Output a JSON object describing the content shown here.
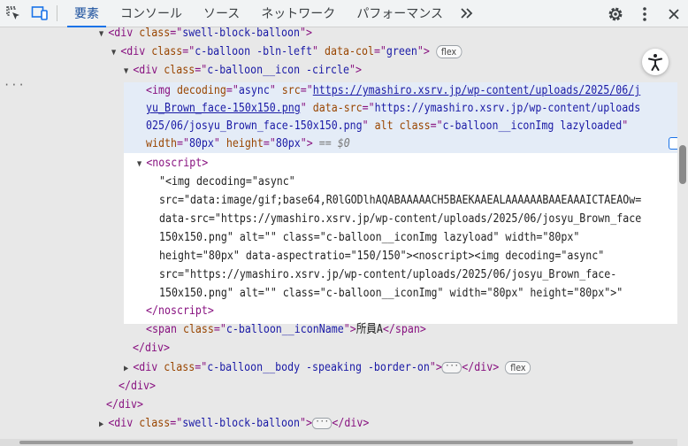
{
  "toolbar": {
    "tabs": [
      {
        "label": "要素",
        "active": true
      },
      {
        "label": "コンソール"
      },
      {
        "label": "ソース"
      },
      {
        "label": "ネットワーク"
      },
      {
        "label": "パフォーマンス"
      }
    ],
    "more_tabs_icon": "double-chevron-right-icon",
    "icons": [
      "inspect-element-icon",
      "device-toolbar-icon",
      "settings-icon",
      "more-vert-icon",
      "close-icon"
    ]
  },
  "tree": {
    "line1": {
      "open": "<div ",
      "attr": "class",
      "eq": "=\"",
      "val": "swell-block-balloon",
      "close": "\">"
    },
    "line2": {
      "open": "<div ",
      "attr": "class",
      "eq": "=\"",
      "val": "c-balloon -bln-left",
      "q": "\" ",
      "attr2": "data-col",
      "eq2": "=\"",
      "val2": "green",
      "close": "\">",
      "badge": "flex"
    },
    "line3": {
      "open": "<div ",
      "attr": "class",
      "eq": "=\"",
      "val": "c-balloon__icon -circle",
      "close": "\">"
    },
    "img": {
      "l1_a": "<img ",
      "l1_b": "decoding",
      "l1_c": "=\"",
      "l1_d": "async",
      "l1_e": "\" ",
      "l1_f": "src",
      "l1_g": "=\"",
      "l1_h": "https://ymashiro.xsrv.jp/wp-content/uploads/2025/06/j",
      "l2_a": "yu_Brown_face-150x150.png",
      "l2_b": "\" ",
      "l2_c": "data-src",
      "l2_d": "=\"",
      "l2_e": "https://ymashiro.xsrv.jp/wp-content/uploads",
      "l3_a": "025/06/josyu_Brown_face-150x150.png",
      "l3_b": "\" ",
      "l3_c": "alt",
      "l3_d": " ",
      "l3_e": "class",
      "l3_f": "=\"",
      "l3_g": "c-balloon__iconImg lazyloaded",
      "l3_h": "\"",
      "l4_a": "width",
      "l4_b": "=\"",
      "l4_c": "80px",
      "l4_d": "\" ",
      "l4_e": "height",
      "l4_f": "=\"",
      "l4_g": "80px",
      "l4_h": "\">",
      "l4_i": " == $0"
    },
    "noscript_open": "<noscript>",
    "noscript_text": [
      "\"<img decoding=\"async\"",
      "src=\"data:image/gif;base64,R0lGODlhAQABAAAAACH5BAEKAAEALAAAAAABAAEAAAICTAEAOw=",
      "data-src=\"https://ymashiro.xsrv.jp/wp-content/uploads/2025/06/josyu_Brown_face",
      "150x150.png\" alt=\"\" class=\"c-balloon__iconImg lazyload\" width=\"80px\"",
      "height=\"80px\" data-aspectratio=\"150/150\"><noscript><img decoding=\"async\"",
      "src=\"https://ymashiro.xsrv.jp/wp-content/uploads/2025/06/josyu_Brown_face-",
      "150x150.png\" alt=\"\" class=\"c-balloon__iconImg\" width=\"80px\" height=\"80px\">\""
    ],
    "noscript_close": "</noscript>",
    "span": {
      "open": "<span ",
      "attr": "class",
      "eq": "=\"",
      "val": "c-balloon__iconName",
      "close": "\">",
      "text": "所員A",
      "end": "</span>"
    },
    "div_close_1": "</div>",
    "body_div": {
      "open": "<div ",
      "attr": "class",
      "eq": "=\"",
      "val": "c-balloon__body -speaking -border-on",
      "close": "\">",
      "ellipsis": "···",
      "end": "</div>",
      "badge": "flex"
    },
    "div_close_2": "</div>",
    "div_close_3": "</div>",
    "last_div": {
      "open": "<div ",
      "attr": "class",
      "eq": "=\"",
      "val": "swell-block-balloon",
      "close": "\">",
      "ellipsis": "···",
      "end": "</div>"
    }
  },
  "gutter_dots": "···",
  "accessibility_icon": "accessibility-icon"
}
